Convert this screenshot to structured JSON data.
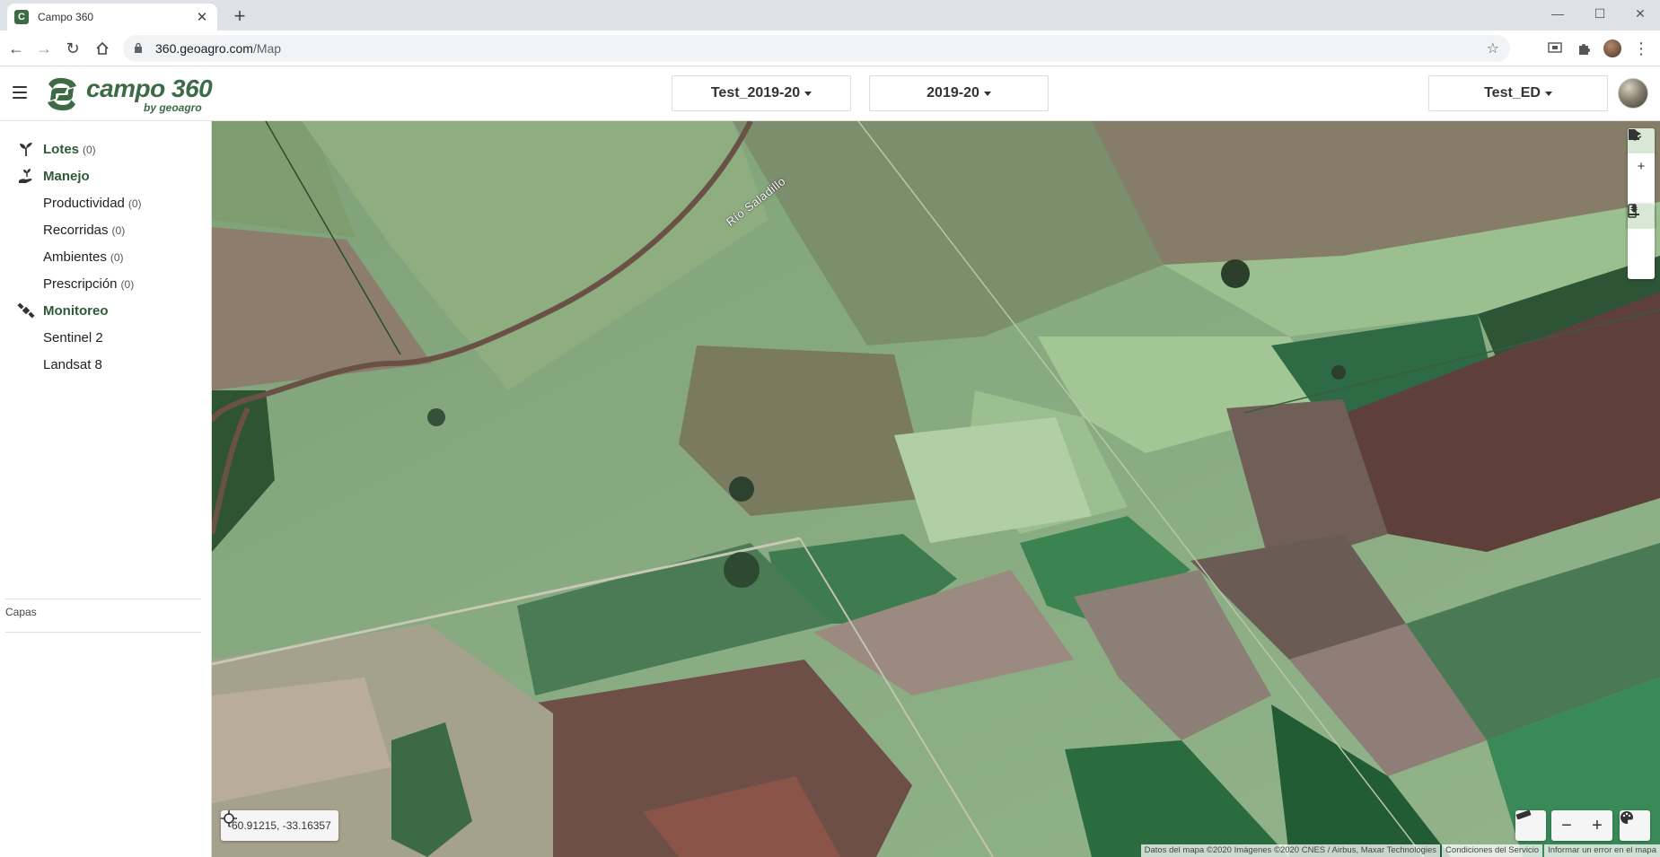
{
  "browser": {
    "tab_title": "Campo 360",
    "new_tab_symbol": "+",
    "url_host": "360.geoagro.com",
    "url_path": "/Map"
  },
  "header": {
    "logo_name": "campo 360",
    "logo_sub": "by geoagro",
    "project_selector": "Test_2019-20",
    "season_selector": "2019-20",
    "account_selector": "Test_ED"
  },
  "sidebar": {
    "lotes": {
      "label": "Lotes",
      "count": "(0)"
    },
    "manejo": {
      "label": "Manejo"
    },
    "productividad": {
      "label": "Productividad",
      "count": "(0)"
    },
    "recorridas": {
      "label": "Recorridas",
      "count": "(0)"
    },
    "ambientes": {
      "label": "Ambientes",
      "count": "(0)"
    },
    "prescripcion": {
      "label": "Prescripción",
      "count": "(0)"
    },
    "monitoreo": {
      "label": "Monitoreo"
    },
    "sentinel": {
      "label": "Sentinel 2"
    },
    "landsat": {
      "label": "Landsat 8"
    },
    "capas_label": "Capas"
  },
  "map": {
    "river_label": "Río Saladillo",
    "coordinates": "-60.91215, -33.16357",
    "attribution": {
      "data": "Datos del mapa ©2020 Imágenes ©2020 CNES / Airbus, Maxar Technologies",
      "terms": "Condiciones del Servicio",
      "report": "Informar un error en el mapa"
    },
    "zoom_out": "−",
    "zoom_in": "+"
  },
  "colors": {
    "brand_green": "#3d6b46",
    "active_tool": "#d8e8d4"
  }
}
